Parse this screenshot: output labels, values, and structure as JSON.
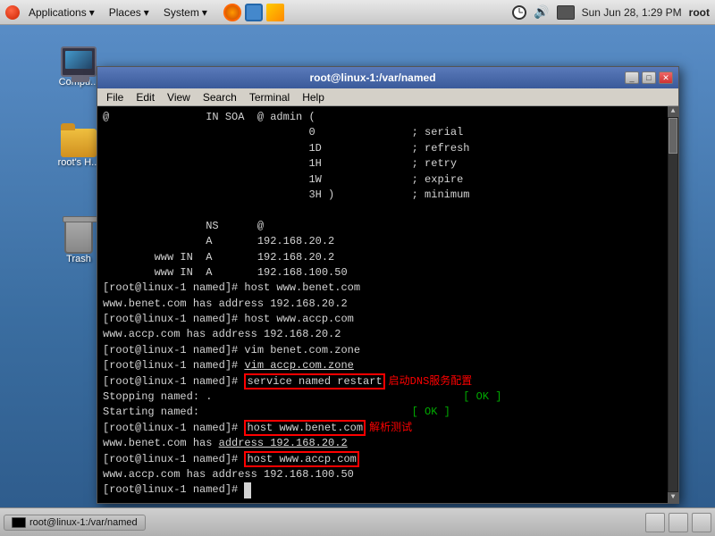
{
  "taskbar": {
    "apps_label": "Applications",
    "places_label": "Places",
    "system_label": "System",
    "datetime": "Sun Jun 28,  1:29 PM",
    "user": "root"
  },
  "desktop_icons": [
    {
      "id": "computer",
      "label": "Compu..."
    },
    {
      "id": "roots-home",
      "label": "root's H..."
    },
    {
      "id": "trash",
      "label": "Trash"
    }
  ],
  "terminal": {
    "title": "root@linux-1:/var/named",
    "menu_items": [
      "File",
      "Edit",
      "View",
      "Search",
      "Terminal",
      "Help"
    ],
    "lines": [
      "@\t\tIN SOA\t@ admin (",
      "\t\t\t\t0\t\t; serial",
      "\t\t\t\t1D\t\t; refresh",
      "\t\t\t\t1H\t\t; retry",
      "\t\t\t\t1W\t\t; expire",
      "\t\t\t\t3H )\t\t; minimum",
      "",
      "\t\tNS\t@",
      "\t\tA\t192.168.20.2",
      "\twww IN\tA\t192.168.20.2",
      "\twww IN\tA\t192.168.100.50",
      "[root@linux-1 named]# host www.benet.com",
      "www.benet.com has address 192.168.20.2",
      "[root@linux-1 named]# host www.accp.com",
      "www.accp.com has address 192.168.20.2",
      "[root@linux-1 named]# vim benet.com.zone",
      "[root@linux-1 named]# vim accp.com.zone",
      "[root@linux-1 named]# service named restart",
      "Stopping named: .\t\t\t\t\t\t[ OK ]",
      "Starting named:\t\t\t\t\t\t[ OK ]",
      "[root@linux-1 named]# host www.benet.com",
      "www.benet.com has address 192.168.20.2",
      "[root@linux-1 named]# host www.accp.com",
      "www.accp.com has address 192.168.100.50",
      "[root@linux-1 named]# "
    ],
    "annotations": [
      {
        "text": "启动DNS服务配置",
        "line": 17
      },
      {
        "text": "解析测试",
        "line": 20
      }
    ]
  },
  "bottom_taskbar": {
    "active_window": "root@linux-1:/var/named"
  }
}
